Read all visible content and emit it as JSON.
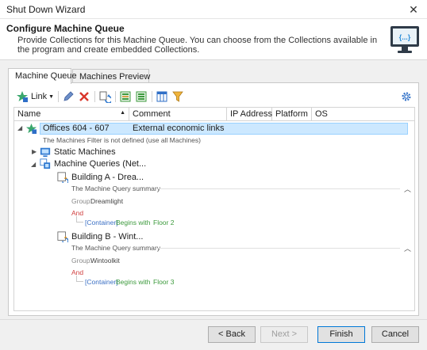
{
  "window": {
    "title": "Shut Down Wizard",
    "close_glyph": "✕"
  },
  "header": {
    "title": "Configure Machine Queue",
    "description": "Provide Collections for this Machine Queue. You can choose from the Collections available in the program and create embedded Collections.",
    "icon": "collection-code-icon",
    "icon_text": "{...}"
  },
  "tabs": [
    {
      "label": "Machine Queue",
      "active": true
    },
    {
      "label": "Machines Preview",
      "active": false
    }
  ],
  "toolbar": {
    "link_label": "Link",
    "items": [
      "link-icon",
      "edit-icon",
      "delete-icon",
      "refresh-icon",
      "expand-all-icon",
      "collapse-all-icon",
      "columns-icon",
      "filter-icon",
      "settings-icon"
    ]
  },
  "grid": {
    "columns": [
      "Name",
      "Comment",
      "IP Address",
      "Platform",
      "OS"
    ],
    "root": {
      "name": "Offices 604 - 607",
      "comment": "External economic links",
      "filter_note": "The Machines Filter is not defined (use all Machines)"
    },
    "static_machines": "Static Machines",
    "machine_queries": "Machine Queries (Net...",
    "queries": [
      {
        "name": "Building A - Drea...",
        "summary": "The Machine Query summary",
        "group_label": "Group:",
        "group_value": "Dreamlight",
        "operator": "And",
        "container": "[Container]",
        "condition": "Begins with",
        "value": "Floor 2"
      },
      {
        "name": "Building B - Wint...",
        "summary": "The Machine Query summary",
        "group_label": "Group:",
        "group_value": "Wintoolkit",
        "operator": "And",
        "container": "[Container]",
        "condition": "Begins with",
        "value": "Floor 3"
      }
    ]
  },
  "buttons": {
    "back": "< Back",
    "next": "Next >",
    "finish": "Finish",
    "cancel": "Cancel"
  },
  "colors": {
    "selection": "#cce8ff",
    "accent": "#0078d7",
    "link_blue": "#3a6fc4",
    "operator_red": "#d04040",
    "condition_green": "#3c9a3c"
  }
}
